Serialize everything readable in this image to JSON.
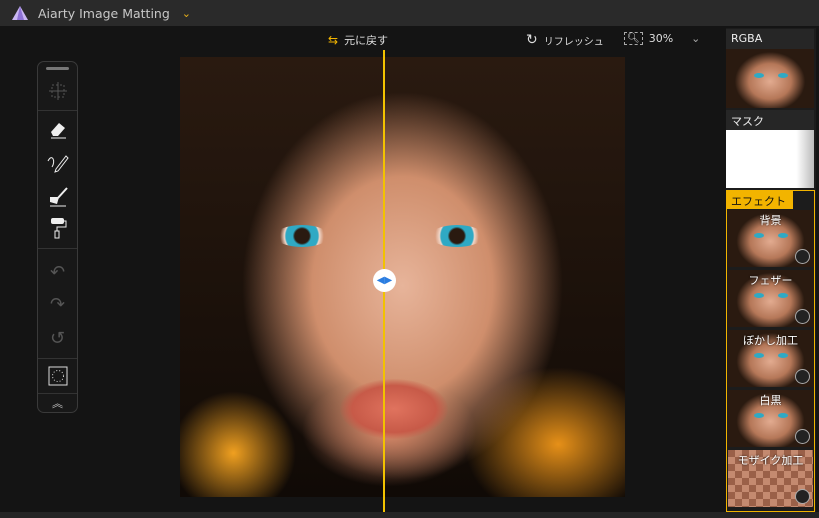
{
  "app": {
    "title": "Aiarty Image Matting"
  },
  "topbar": {
    "undo_label": "元に戻す",
    "refresh_label": "リフレッシュ",
    "zoom": "30%"
  },
  "toolbar": {
    "tools": [
      "select-move",
      "eraser",
      "brush-pencil",
      "restore-brush",
      "roller",
      "undo",
      "redo",
      "reset",
      "lasso-select",
      "collapse"
    ]
  },
  "right_panel": {
    "rgba_label": "RGBA",
    "mask_label": "マスク",
    "effects_label": "エフェクト",
    "effects": [
      {
        "label": "背景"
      },
      {
        "label": "フェザー"
      },
      {
        "label": "ぼかし加工"
      },
      {
        "label": "白黒"
      },
      {
        "label": "モザイク加工"
      }
    ]
  },
  "colors": {
    "accent": "#f2b400",
    "background": "#141414",
    "divider": "#f2c200"
  }
}
